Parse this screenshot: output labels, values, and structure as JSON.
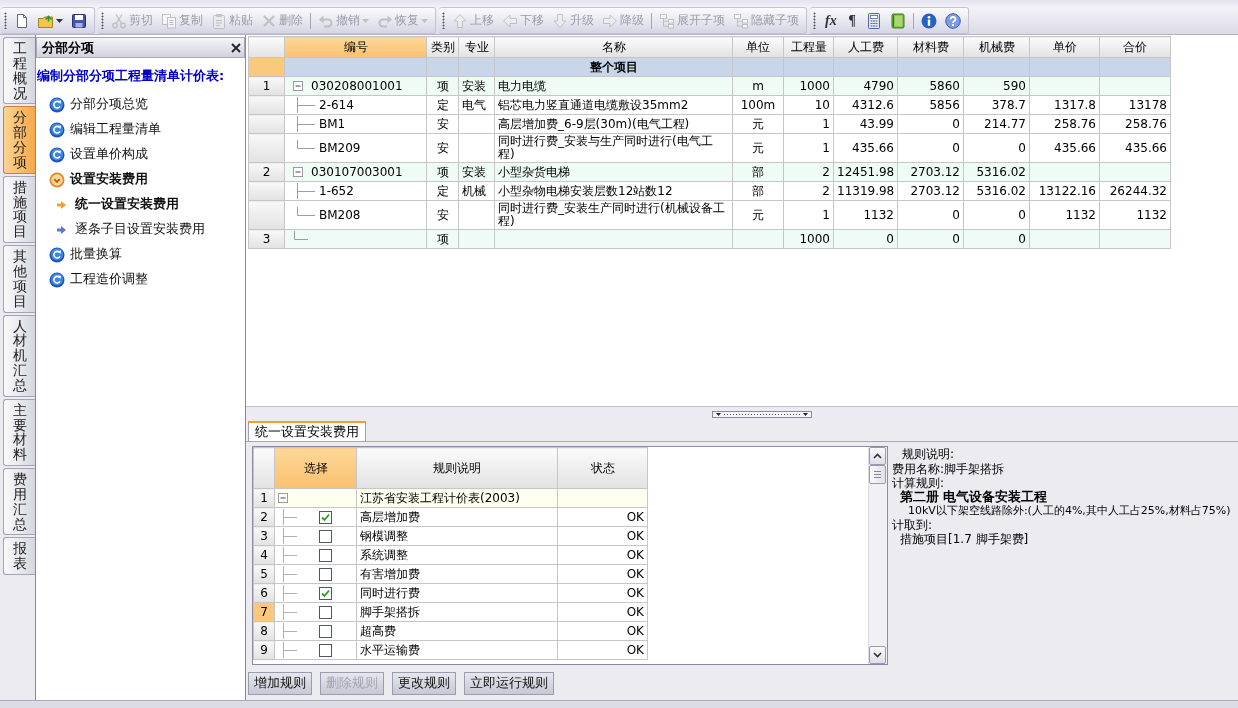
{
  "toolbar": [
    {
      "items": [
        {
          "kind": "button",
          "disabled": false,
          "dropdown": false
        },
        {
          "kind": "button",
          "disabled": false,
          "dropdown": true
        },
        {
          "kind": "button",
          "disabled": false,
          "dropdown": false
        }
      ]
    },
    {
      "items": [
        {
          "kind": "button",
          "label": "剪切",
          "disabled": true,
          "dropdown": false
        },
        {
          "kind": "button",
          "label": "复制",
          "disabled": true,
          "dropdown": false
        },
        {
          "kind": "button",
          "label": "粘贴",
          "disabled": true,
          "dropdown": false
        },
        {
          "kind": "button",
          "label": "删除",
          "disabled": true,
          "dropdown": false
        },
        {
          "kind": "separator"
        },
        {
          "kind": "button",
          "label": "撤销",
          "disabled": true,
          "dropdown": true
        },
        {
          "kind": "button",
          "label": "恢复",
          "disabled": true,
          "dropdown": true
        }
      ]
    },
    {
      "items": [
        {
          "kind": "button",
          "label": "上移",
          "disabled": true,
          "dropdown": false
        },
        {
          "kind": "button",
          "label": "下移",
          "disabled": true,
          "dropdown": false
        },
        {
          "kind": "button",
          "label": "升级",
          "disabled": true,
          "dropdown": false
        },
        {
          "kind": "button",
          "label": "降级",
          "disabled": true,
          "dropdown": false
        },
        {
          "kind": "separator"
        },
        {
          "kind": "button",
          "label": "展开子项",
          "disabled": true,
          "dropdown": false
        },
        {
          "kind": "button",
          "label": "隐藏子项",
          "disabled": true,
          "dropdown": false
        }
      ]
    },
    {
      "items": [
        {
          "kind": "glyph",
          "label": "fx",
          "disabled": false,
          "dropdown": false
        },
        {
          "kind": "glyph",
          "label": "¶",
          "disabled": false,
          "dropdown": false
        },
        {
          "kind": "button",
          "disabled": false,
          "dropdown": false
        },
        {
          "kind": "button",
          "disabled": false,
          "dropdown": false
        },
        {
          "kind": "separator"
        },
        {
          "kind": "button",
          "disabled": false,
          "dropdown": false
        },
        {
          "kind": "button",
          "disabled": false,
          "dropdown": false
        }
      ]
    }
  ],
  "side_tabs": [
    {
      "label": "工程概况",
      "selected": false
    },
    {
      "label": "分部分项",
      "selected": true
    },
    {
      "label": "措施项目",
      "selected": false
    },
    {
      "label": "其他项目",
      "selected": false
    },
    {
      "label": "人材机汇总",
      "selected": false
    },
    {
      "label": "主要材料",
      "selected": false
    },
    {
      "label": "费用汇总",
      "selected": false
    },
    {
      "label": "报表",
      "selected": false
    }
  ],
  "nav": {
    "title": "分部分项",
    "heading": "编制分部分项工程量清单计价表:",
    "items": [
      {
        "label": "分部分项总览",
        "selected": false
      },
      {
        "label": "编辑工程量清单",
        "selected": false
      },
      {
        "label": "设置单价构成",
        "selected": false
      },
      {
        "label": "设置安装费用",
        "selected": true,
        "children": [
          {
            "label": "统一设置安装费用",
            "selected": true
          },
          {
            "label": "逐条子目设置安装费用",
            "selected": false
          }
        ]
      },
      {
        "label": "批量换算",
        "selected": false
      },
      {
        "label": "工程造价调整",
        "selected": false
      }
    ]
  },
  "grid": {
    "columns": [
      {
        "label": "编号",
        "selected": true
      },
      {
        "label": "类别",
        "selected": false
      },
      {
        "label": "专业",
        "selected": false
      },
      {
        "label": "名称",
        "selected": false
      },
      {
        "label": "单位",
        "selected": false
      },
      {
        "label": "工程量",
        "selected": false
      },
      {
        "label": "人工费",
        "selected": false
      },
      {
        "label": "材料费",
        "selected": false
      },
      {
        "label": "机械费",
        "selected": false
      },
      {
        "label": "单价",
        "selected": false
      },
      {
        "label": "合价",
        "selected": false
      }
    ],
    "rows": [
      {
        "kind": "project",
        "selected": true,
        "label": "整个项目"
      },
      {
        "kind": "item",
        "no": "1",
        "selected": false,
        "expanded": true,
        "code": "030208001001",
        "type": "项",
        "specialty": "安装",
        "name": "电力电缆",
        "unit": "m",
        "qty": "1000",
        "labor": "4790",
        "material": "5860",
        "machine": "590",
        "children": [
          {
            "kind": "sub",
            "selected": false,
            "code": "2-614",
            "type": "定",
            "specialty": "电气",
            "name": "铝芯电力竖直通道电缆敷设35mm2",
            "unit": "100m",
            "qty": "10",
            "labor": "4312.6",
            "material": "5856",
            "machine": "378.7",
            "unit_price": "1317.8",
            "total": "13178"
          },
          {
            "kind": "sub",
            "selected": false,
            "code": "BM1",
            "type": "安",
            "name": "高层增加费_6-9层(30m)(电气工程)",
            "unit": "元",
            "qty": "1",
            "labor": "43.99",
            "material": "0",
            "machine": "214.77",
            "unit_price": "258.76",
            "total": "258.76"
          },
          {
            "kind": "sub",
            "selected": false,
            "code": "BM209",
            "type": "安",
            "name": "同时进行费_安装与生产同时进行(电气工程)",
            "unit": "元",
            "qty": "1",
            "labor": "435.66",
            "material": "0",
            "machine": "0",
            "unit_price": "435.66",
            "total": "435.66"
          }
        ]
      },
      {
        "kind": "item",
        "no": "2",
        "selected": false,
        "expanded": true,
        "code": "030107003001",
        "type": "项",
        "specialty": "安装",
        "name": "小型杂货电梯",
        "unit": "部",
        "qty": "2",
        "labor": "12451.98",
        "material": "2703.12",
        "machine": "5316.02",
        "children": [
          {
            "kind": "sub",
            "selected": false,
            "code": "1-652",
            "type": "定",
            "specialty": "机械",
            "name": "小型杂物电梯安装层数12站数12",
            "unit": "部",
            "qty": "2",
            "labor": "11319.98",
            "material": "2703.12",
            "machine": "5316.02",
            "unit_price": "13122.16",
            "total": "26244.32"
          },
          {
            "kind": "sub",
            "selected": false,
            "code": "BM208",
            "type": "安",
            "name": "同时进行费_安装生产同时进行(机械设备工程)",
            "unit": "元",
            "qty": "1",
            "labor": "1132",
            "material": "0",
            "machine": "0",
            "unit_price": "1132",
            "total": "1132"
          }
        ]
      },
      {
        "kind": "item",
        "no": "3",
        "selected": false,
        "type": "项",
        "qty": "1000",
        "labor": "0",
        "material": "0",
        "machine": "0"
      }
    ]
  },
  "bottom": {
    "tabs": [
      {
        "label": "统一设置安装费用",
        "selected": true
      }
    ],
    "rules": {
      "columns": [
        {
          "label": "选择",
          "selected": true
        },
        {
          "label": "规则说明",
          "selected": false
        },
        {
          "label": "状态",
          "selected": false
        }
      ],
      "rows": [
        {
          "no": "1",
          "selected": false,
          "expanded": true,
          "description": "江苏省安装工程计价表(2003)",
          "children": [
            {
              "no": "2",
              "selected": false,
              "checked": true,
              "description": "高层增加费",
              "status": "OK"
            },
            {
              "no": "3",
              "selected": false,
              "checked": false,
              "description": "钢模调整",
              "status": "OK"
            },
            {
              "no": "4",
              "selected": false,
              "checked": false,
              "description": "系统调整",
              "status": "OK"
            },
            {
              "no": "5",
              "selected": false,
              "checked": false,
              "description": "有害增加费",
              "status": "OK"
            },
            {
              "no": "6",
              "selected": false,
              "checked": true,
              "description": "同时进行费",
              "status": "OK"
            },
            {
              "no": "7",
              "selected": true,
              "checked": false,
              "description": "脚手架搭拆",
              "status": "OK"
            },
            {
              "no": "8",
              "selected": false,
              "checked": false,
              "description": "超高费",
              "status": "OK"
            },
            {
              "no": "9",
              "selected": false,
              "checked": false,
              "description": "水平运输费",
              "status": "OK"
            }
          ]
        }
      ]
    },
    "detail": {
      "title": "规则说明:",
      "lines": [
        {
          "kind": "field",
          "text": "费用名称:脚手架搭拆"
        },
        {
          "kind": "field",
          "text": "计算规则:"
        },
        {
          "kind": "heading",
          "text": "第二册 电气设备安装工程"
        },
        {
          "kind": "note",
          "text": "10kV以下架空线路除外:(人工的4%,其中人工占25%,材料占75%)"
        },
        {
          "kind": "field",
          "text": "计取到:"
        },
        {
          "kind": "value",
          "text": "措施项目[1.7 脚手架费]"
        }
      ]
    },
    "buttons": [
      {
        "label": "增加规则",
        "disabled": false
      },
      {
        "label": "删除规则",
        "disabled": true
      },
      {
        "label": "更改规则",
        "disabled": false
      },
      {
        "label": "立即运行规则",
        "disabled": false
      }
    ]
  }
}
